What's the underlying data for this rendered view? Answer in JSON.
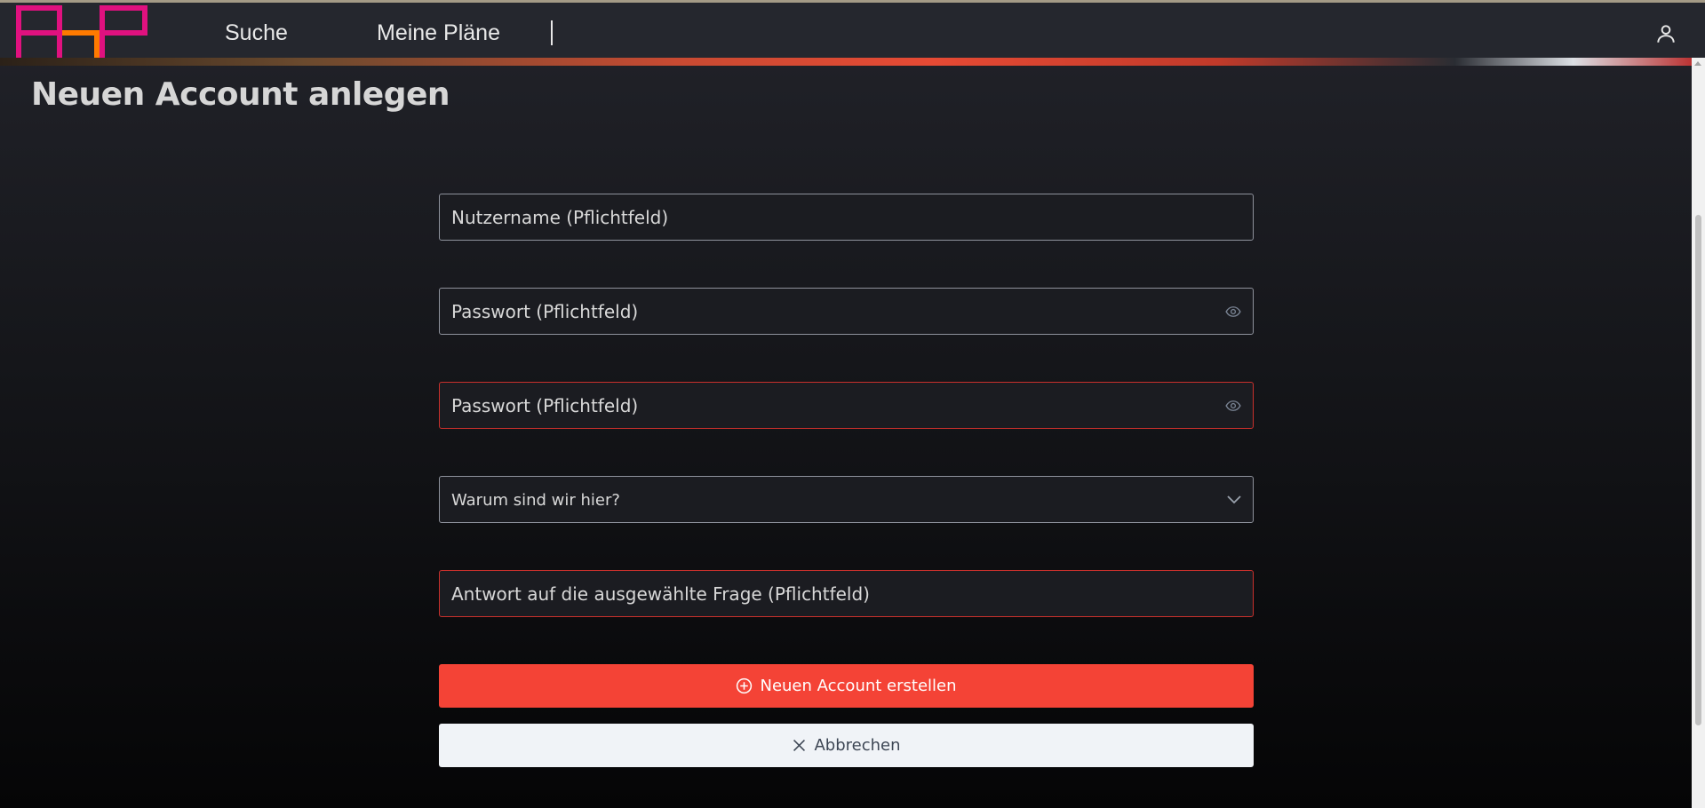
{
  "header": {
    "logo_name": "app-logo",
    "nav": [
      {
        "label": "Suche"
      },
      {
        "label": "Meine Pläne"
      }
    ],
    "user_icon": "user-icon"
  },
  "page": {
    "title": "Neuen Account anlegen"
  },
  "form": {
    "username_placeholder": "Nutzername (Pflichtfeld)",
    "password_placeholder": "Passwort (Pflichtfeld)",
    "password_repeat_placeholder": "Passwort (Pflichtfeld)",
    "security_question_selected": "Warum sind wir hier?",
    "answer_placeholder": "Antwort auf die ausgewählte Frage (Pflichtfeld)",
    "submit_label": "Neuen Account erstellen",
    "cancel_label": "Abbrechen"
  },
  "colors": {
    "accent": "#f44336",
    "error_border": "#c9302c",
    "logo_magenta": "#e0117f",
    "logo_orange": "#ff7a00"
  }
}
